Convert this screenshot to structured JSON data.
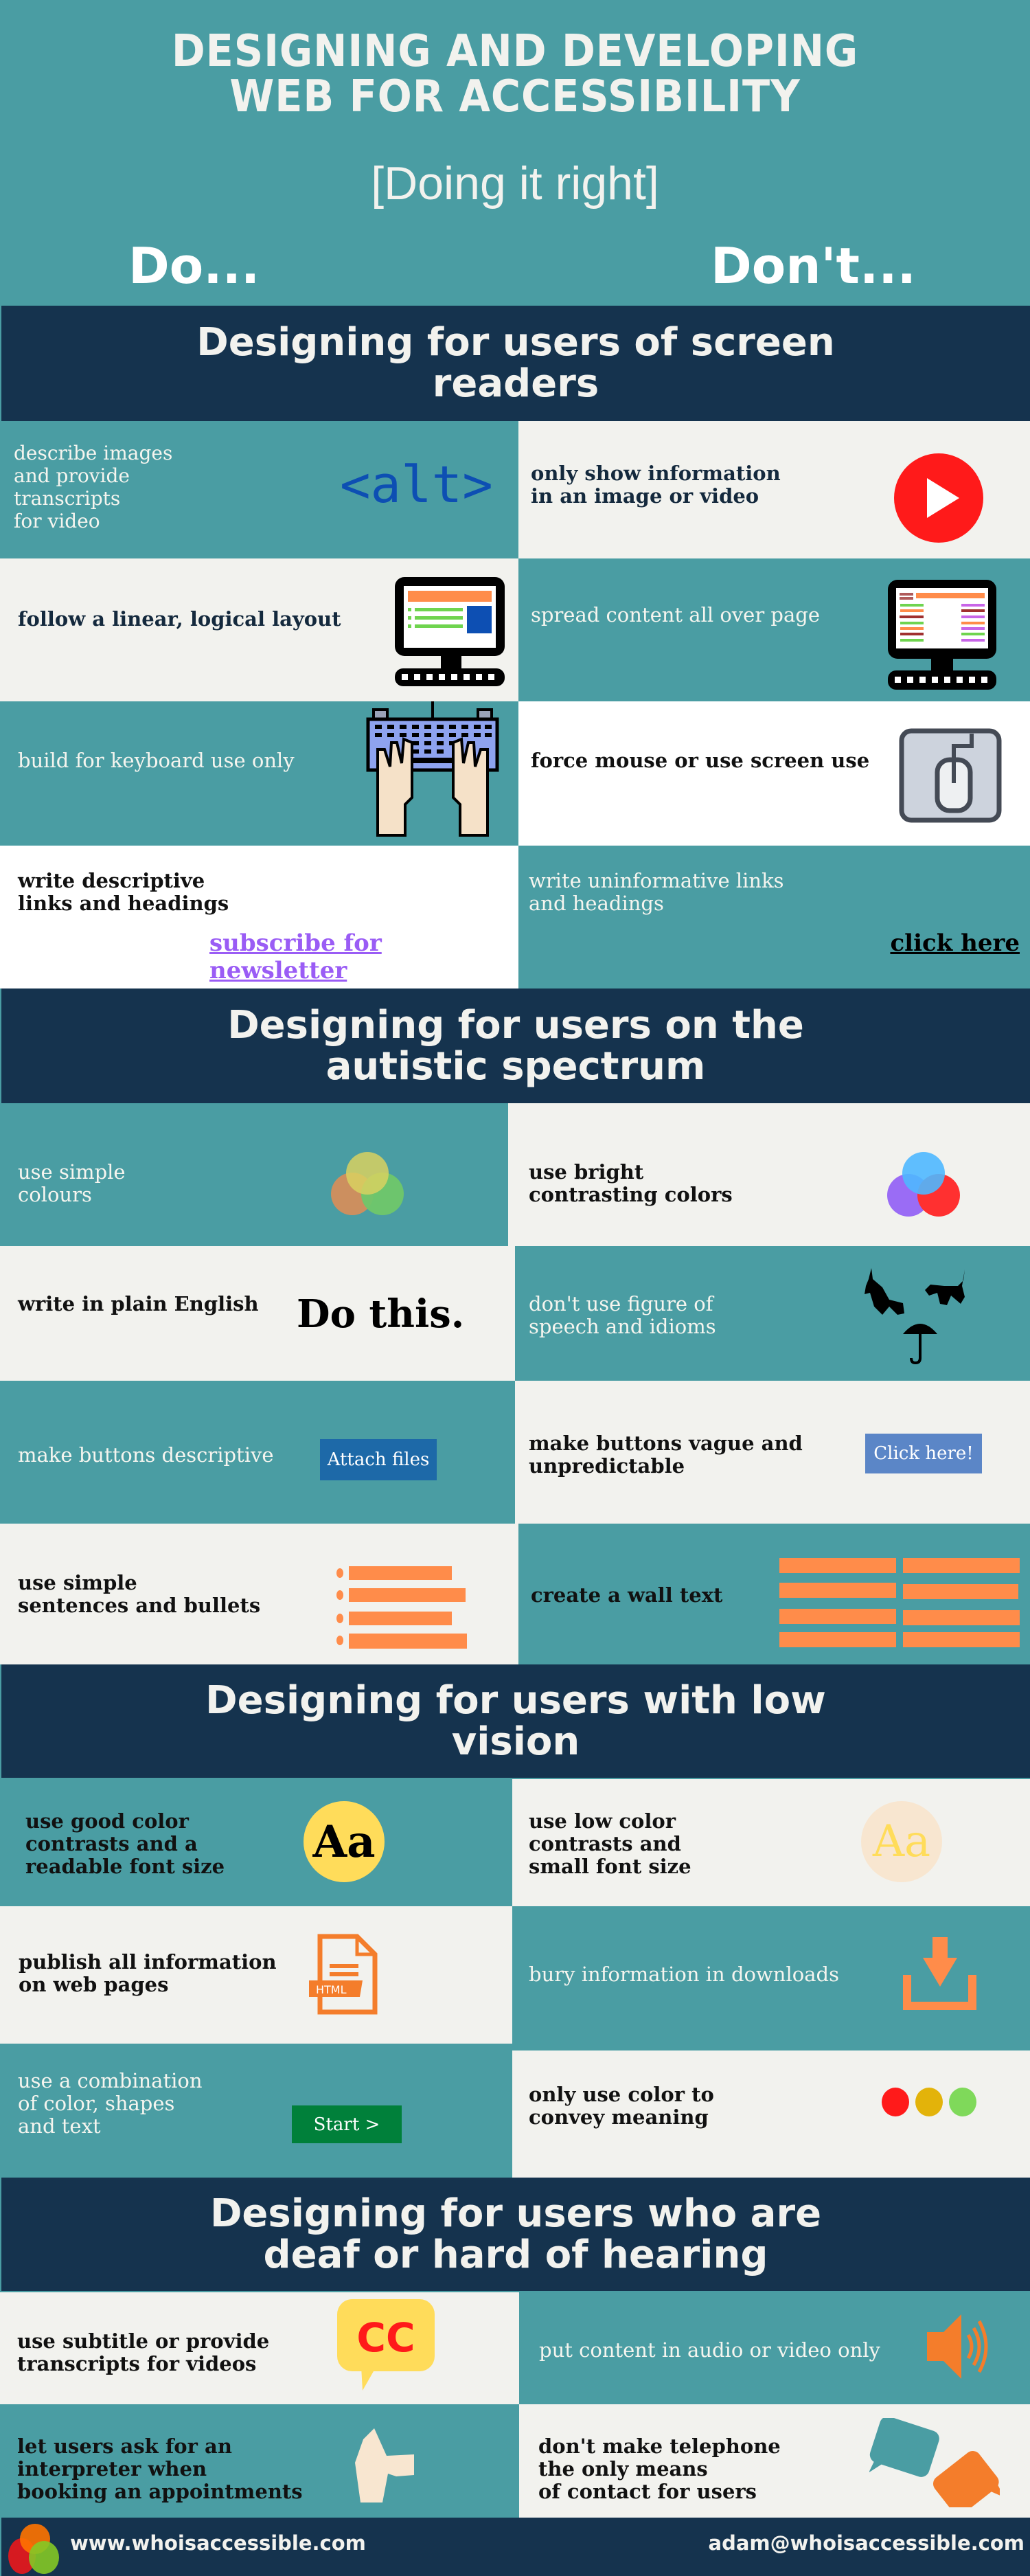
{
  "hero": {
    "title_line1": "DESIGNING AND DEVELOPING",
    "title_line2": "WEB FOR ACCESSIBILITY",
    "subtitle": "[Doing it right]",
    "do_label": "Do...",
    "dont_label": "Don't..."
  },
  "sections": [
    {
      "title": "Designing for users of screen readers",
      "rows": [
        {
          "do": "describe images\nand provide\ntranscripts\nfor video",
          "do_icon": "alt-tag-icon",
          "do_icon_text": "<alt>",
          "dont": "only show information\nin an image or video",
          "dont_icon": "play-video-icon"
        },
        {
          "do": "follow a linear, logical layout",
          "do_icon": "monitor-linear-layout-icon",
          "dont": "spread content all over page",
          "dont_icon": "monitor-scattered-layout-icon"
        },
        {
          "do": "build for keyboard use only",
          "do_icon": "keyboard-hands-icon",
          "dont": "force mouse or use screen use",
          "dont_icon": "mouse-icon"
        },
        {
          "do": "write descriptive\nlinks and headings",
          "do_link": "subscribe for newsletter",
          "dont": "write uninformative links\nand headings",
          "dont_link": "click here"
        }
      ]
    },
    {
      "title": "Designing for users on the autistic spectrum",
      "rows": [
        {
          "do": "use simple\ncolours",
          "do_icon": "muted-venn-circles-icon",
          "dont": "use bright\ncontrasting colors",
          "dont_icon": "bright-venn-circles-icon"
        },
        {
          "do": "write in plain English",
          "do_sample": "Do this.",
          "dont": "don't use figure of\nspeech and idioms",
          "dont_icon": "raining-cats-dogs-umbrella-icon"
        },
        {
          "do": "make buttons descriptive",
          "do_button": "Attach files",
          "dont": "make buttons vague and\nunpredictable",
          "dont_button": "Click here!"
        },
        {
          "do": "use simple\nsentences and bullets",
          "do_icon": "bullet-list-icon",
          "dont": "create a wall text",
          "dont_icon": "wall-of-text-icon"
        }
      ]
    },
    {
      "title": "Designing for users with low vision",
      "rows": [
        {
          "do": "use good color\ncontrasts and a\nreadable font size",
          "do_icon": "high-contrast-font-icon",
          "do_icon_text": "Aa",
          "dont": "use low color\ncontrasts and\nsmall font size",
          "dont_icon": "low-contrast-font-icon",
          "dont_icon_text": "Aa"
        },
        {
          "do": "publish all information\non web pages",
          "do_icon": "html-file-icon",
          "do_icon_text": "HTML",
          "dont": "bury information in downloads",
          "dont_icon": "download-icon"
        },
        {
          "do": "use a combination\nof color, shapes\nand text",
          "do_button": "Start >",
          "dont": "only use color to\nconvey meaning",
          "dont_icon": "color-dots-icon"
        }
      ]
    },
    {
      "title": "Designing for users who are deaf or hard of hearing",
      "rows": [
        {
          "do": "use subtitle or provide\ntranscripts for videos",
          "do_icon": "closed-caption-icon",
          "do_icon_text": "CC",
          "dont": "put content in audio or video only",
          "dont_icon": "speaker-icon"
        },
        {
          "do": "let users ask for an\ninterpreter when\nbooking an appointments",
          "do_icon": "sign-language-hand-icon",
          "dont": "don't make telephone\nthe only means\nof contact for users",
          "dont_icon": "speech-bubbles-icon"
        }
      ]
    }
  ],
  "footer": {
    "url": "www.whoisaccessible.com",
    "email": "adam@whoisaccessible.com"
  },
  "colors": {
    "teal": "#4a9da3",
    "navy": "#15334e",
    "light": "#f2f2ee",
    "orange": "#ff8c4a",
    "link_purple": "#9a5cf5",
    "alt_blue": "#0d4fb3",
    "play_red": "#ff1a1a"
  }
}
